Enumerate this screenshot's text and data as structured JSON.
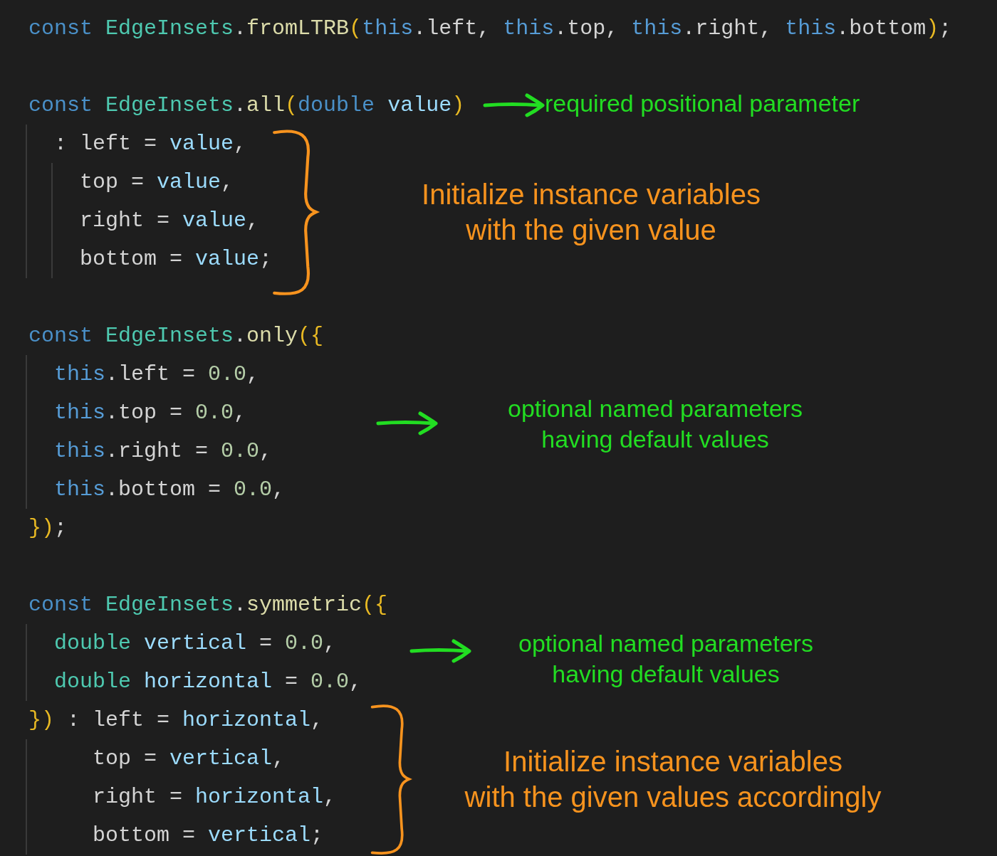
{
  "code_blocks": [
    {
      "lines": [
        [
          {
            "text": "const",
            "kind": "keyword"
          },
          {
            "text": " EdgeInsets",
            "kind": "class"
          },
          {
            "text": ".",
            "kind": "plain"
          },
          {
            "text": "fromLTRB",
            "kind": "method"
          },
          {
            "text": "(",
            "kind": "bracket"
          },
          {
            "text": "this",
            "kind": "this"
          },
          {
            "text": ".left, ",
            "kind": "plain"
          },
          {
            "text": "this",
            "kind": "this"
          },
          {
            "text": ".top, ",
            "kind": "plain"
          },
          {
            "text": "this",
            "kind": "this"
          },
          {
            "text": ".right, ",
            "kind": "plain"
          },
          {
            "text": "this",
            "kind": "this"
          },
          {
            "text": ".bottom",
            "kind": "plain"
          },
          {
            "text": ")",
            "kind": "bracket"
          },
          {
            "text": ";",
            "kind": "plain"
          }
        ]
      ]
    },
    {
      "lines": [
        [
          {
            "text": "const",
            "kind": "keyword"
          },
          {
            "text": " EdgeInsets",
            "kind": "class"
          },
          {
            "text": ".",
            "kind": "plain"
          },
          {
            "text": "all",
            "kind": "method"
          },
          {
            "text": "(",
            "kind": "bracket"
          },
          {
            "text": "double",
            "kind": "keyword"
          },
          {
            "text": " value",
            "kind": "variable"
          },
          {
            "text": ")",
            "kind": "bracket"
          }
        ],
        [
          {
            "text": "  : left = ",
            "kind": "plain"
          },
          {
            "text": "value",
            "kind": "variable"
          },
          {
            "text": ",",
            "kind": "plain"
          }
        ],
        [
          {
            "text": "    top = ",
            "kind": "plain"
          },
          {
            "text": "value",
            "kind": "variable"
          },
          {
            "text": ",",
            "kind": "plain"
          }
        ],
        [
          {
            "text": "    right = ",
            "kind": "plain"
          },
          {
            "text": "value",
            "kind": "variable"
          },
          {
            "text": ",",
            "kind": "plain"
          }
        ],
        [
          {
            "text": "    bottom = ",
            "kind": "plain"
          },
          {
            "text": "value",
            "kind": "variable"
          },
          {
            "text": ";",
            "kind": "plain"
          }
        ]
      ]
    },
    {
      "lines": [
        [
          {
            "text": "const",
            "kind": "keyword"
          },
          {
            "text": " EdgeInsets",
            "kind": "class"
          },
          {
            "text": ".",
            "kind": "plain"
          },
          {
            "text": "only",
            "kind": "method"
          },
          {
            "text": "({",
            "kind": "bracket"
          }
        ],
        [
          {
            "text": "  this",
            "kind": "this"
          },
          {
            "text": ".left = ",
            "kind": "plain"
          },
          {
            "text": "0.0",
            "kind": "number"
          },
          {
            "text": ",",
            "kind": "plain"
          }
        ],
        [
          {
            "text": "  this",
            "kind": "this"
          },
          {
            "text": ".top = ",
            "kind": "plain"
          },
          {
            "text": "0.0",
            "kind": "number"
          },
          {
            "text": ",",
            "kind": "plain"
          }
        ],
        [
          {
            "text": "  this",
            "kind": "this"
          },
          {
            "text": ".right = ",
            "kind": "plain"
          },
          {
            "text": "0.0",
            "kind": "number"
          },
          {
            "text": ",",
            "kind": "plain"
          }
        ],
        [
          {
            "text": "  this",
            "kind": "this"
          },
          {
            "text": ".bottom = ",
            "kind": "plain"
          },
          {
            "text": "0.0",
            "kind": "number"
          },
          {
            "text": ",",
            "kind": "plain"
          }
        ],
        [
          {
            "text": "})",
            "kind": "bracket"
          },
          {
            "text": ";",
            "kind": "plain"
          }
        ]
      ]
    },
    {
      "lines": [
        [
          {
            "text": "const",
            "kind": "keyword"
          },
          {
            "text": " EdgeInsets",
            "kind": "class"
          },
          {
            "text": ".",
            "kind": "plain"
          },
          {
            "text": "symmetric",
            "kind": "method"
          },
          {
            "text": "({",
            "kind": "bracket"
          }
        ],
        [
          {
            "text": "  double",
            "kind": "class"
          },
          {
            "text": " vertical",
            "kind": "variable"
          },
          {
            "text": " = ",
            "kind": "plain"
          },
          {
            "text": "0.0",
            "kind": "number"
          },
          {
            "text": ",",
            "kind": "plain"
          }
        ],
        [
          {
            "text": "  double",
            "kind": "class"
          },
          {
            "text": " horizontal",
            "kind": "variable"
          },
          {
            "text": " = ",
            "kind": "plain"
          },
          {
            "text": "0.0",
            "kind": "number"
          },
          {
            "text": ",",
            "kind": "plain"
          }
        ],
        [
          {
            "text": "})",
            "kind": "bracket"
          },
          {
            "text": " : left = ",
            "kind": "plain"
          },
          {
            "text": "horizontal",
            "kind": "variable"
          },
          {
            "text": ",",
            "kind": "plain"
          }
        ],
        [
          {
            "text": "     top = ",
            "kind": "plain"
          },
          {
            "text": "vertical",
            "kind": "variable"
          },
          {
            "text": ",",
            "kind": "plain"
          }
        ],
        [
          {
            "text": "     right = ",
            "kind": "plain"
          },
          {
            "text": "horizontal",
            "kind": "variable"
          },
          {
            "text": ",",
            "kind": "plain"
          }
        ],
        [
          {
            "text": "     bottom = ",
            "kind": "plain"
          },
          {
            "text": "vertical",
            "kind": "variable"
          },
          {
            "text": ";",
            "kind": "plain"
          }
        ]
      ]
    }
  ],
  "annotations": [
    {
      "lines": [
        "required positional parameter"
      ],
      "color": "#22dd22"
    },
    {
      "lines": [
        "Initialize instance variables",
        "with the given value"
      ],
      "color": "#f7931e"
    },
    {
      "lines": [
        "optional named parameters",
        "having default values"
      ],
      "color": "#22dd22"
    },
    {
      "lines": [
        "optional named parameters",
        "having default values"
      ],
      "color": "#22dd22"
    },
    {
      "lines": [
        "Initialize instance variables",
        "with the given values accordingly"
      ],
      "color": "#f7931e"
    }
  ]
}
